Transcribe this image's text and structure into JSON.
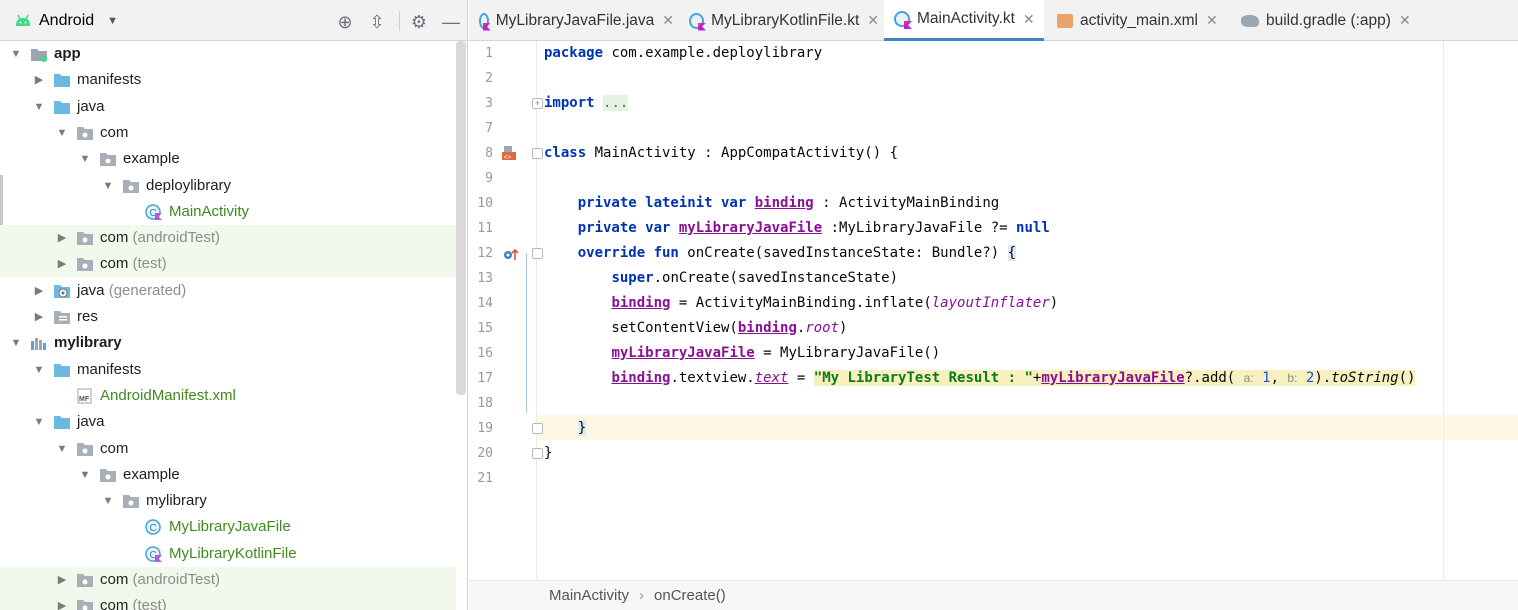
{
  "project_panel": {
    "view_name": "Android",
    "tree": [
      {
        "label": "app",
        "suffix": "",
        "type": "module",
        "depth": 0,
        "expanded": true,
        "bold": true,
        "green": false,
        "selected": false
      },
      {
        "label": "manifests",
        "suffix": "",
        "type": "folder",
        "depth": 1,
        "expanded": false,
        "bold": false,
        "green": false,
        "selected": false
      },
      {
        "label": "java",
        "suffix": "",
        "type": "folder",
        "depth": 1,
        "expanded": true,
        "bold": false,
        "green": false,
        "selected": false
      },
      {
        "label": "com",
        "suffix": "",
        "type": "package",
        "depth": 2,
        "expanded": true,
        "bold": false,
        "green": false,
        "selected": false
      },
      {
        "label": "example",
        "suffix": "",
        "type": "package",
        "depth": 3,
        "expanded": true,
        "bold": false,
        "green": false,
        "selected": false
      },
      {
        "label": "deploylibrary",
        "suffix": "",
        "type": "package",
        "depth": 4,
        "expanded": true,
        "bold": false,
        "green": false,
        "selected": false
      },
      {
        "label": "MainActivity",
        "suffix": "",
        "type": "kotlin",
        "depth": 5,
        "expanded": null,
        "bold": false,
        "green": true,
        "selected": false
      },
      {
        "label": "com",
        "suffix": "(androidTest)",
        "type": "package",
        "depth": 2,
        "expanded": false,
        "bold": false,
        "green": false,
        "selected": true
      },
      {
        "label": "com",
        "suffix": "(test)",
        "type": "package",
        "depth": 2,
        "expanded": false,
        "bold": false,
        "green": false,
        "selected": true
      },
      {
        "label": "java",
        "suffix": "(generated)",
        "type": "gen",
        "depth": 1,
        "expanded": false,
        "bold": false,
        "green": false,
        "selected": false
      },
      {
        "label": "res",
        "suffix": "",
        "type": "res",
        "depth": 1,
        "expanded": false,
        "bold": false,
        "green": false,
        "selected": false
      },
      {
        "label": "mylibrary",
        "suffix": "",
        "type": "library",
        "depth": 0,
        "expanded": true,
        "bold": true,
        "green": false,
        "selected": false
      },
      {
        "label": "manifests",
        "suffix": "",
        "type": "folder",
        "depth": 1,
        "expanded": true,
        "bold": false,
        "green": false,
        "selected": false
      },
      {
        "label": "AndroidManifest.xml",
        "suffix": "",
        "type": "manifest",
        "depth": 2,
        "expanded": null,
        "bold": false,
        "green": true,
        "selected": false
      },
      {
        "label": "java",
        "suffix": "",
        "type": "folder",
        "depth": 1,
        "expanded": true,
        "bold": false,
        "green": false,
        "selected": false
      },
      {
        "label": "com",
        "suffix": "",
        "type": "package",
        "depth": 2,
        "expanded": true,
        "bold": false,
        "green": false,
        "selected": false
      },
      {
        "label": "example",
        "suffix": "",
        "type": "package",
        "depth": 3,
        "expanded": true,
        "bold": false,
        "green": false,
        "selected": false
      },
      {
        "label": "mylibrary",
        "suffix": "",
        "type": "package",
        "depth": 4,
        "expanded": true,
        "bold": false,
        "green": false,
        "selected": false
      },
      {
        "label": "MyLibraryJavaFile",
        "suffix": "",
        "type": "java",
        "depth": 5,
        "expanded": null,
        "bold": false,
        "green": true,
        "selected": false
      },
      {
        "label": "MyLibraryKotlinFile",
        "suffix": "",
        "type": "kotlin",
        "depth": 5,
        "expanded": null,
        "bold": false,
        "green": true,
        "selected": false
      },
      {
        "label": "com",
        "suffix": "(androidTest)",
        "type": "package",
        "depth": 2,
        "expanded": false,
        "bold": false,
        "green": false,
        "selected": true
      },
      {
        "label": "com",
        "suffix": "(test)",
        "type": "package",
        "depth": 2,
        "expanded": false,
        "bold": false,
        "green": false,
        "selected": true
      }
    ]
  },
  "tabs": [
    {
      "label": "MyLibraryJavaFile.java",
      "icon": "java-class-icon",
      "active": false
    },
    {
      "label": "MyLibraryKotlinFile.kt",
      "icon": "kotlin-class-icon",
      "active": false
    },
    {
      "label": "MainActivity.kt",
      "icon": "kotlin-class-icon",
      "active": true
    },
    {
      "label": "activity_main.xml",
      "icon": "layout-xml-icon",
      "active": false
    },
    {
      "label": "build.gradle (:app)",
      "icon": "gradle-icon",
      "active": false
    }
  ],
  "editor": {
    "lines": [
      {
        "n": "1",
        "html": "<span class='kw'>package</span> com.example.deploylibrary"
      },
      {
        "n": "2",
        "html": ""
      },
      {
        "n": "3",
        "html": "<span class='kw'>import</span> <span style='background:#e8f2e3;color:#3f8a1c'>...</span>"
      },
      {
        "n": "7",
        "html": ""
      },
      {
        "n": "8",
        "html": "<span class='kw'>class</span> MainActivity : AppCompatActivity() {"
      },
      {
        "n": "9",
        "html": ""
      },
      {
        "n": "10",
        "html": "    <span class='kw'>private lateinit var</span> <span class='ul'>binding</span> : ActivityMainBinding"
      },
      {
        "n": "11",
        "html": "    <span class='kw'>private var</span> <span class='ul'>myLibraryJavaFile</span> :MyLibraryJavaFile ?= <span class='kw'>null</span>"
      },
      {
        "n": "12",
        "html": "    <span class='kw'>override fun</span> onCreate(savedInstanceState: Bundle?) <span style='background:#dfe8f6'>{</span>"
      },
      {
        "n": "13",
        "html": "        <span class='kw'>super</span>.onCreate(savedInstanceState)"
      },
      {
        "n": "14",
        "html": "        <span class='ul'>binding</span> = ActivityMainBinding.inflate(<span class='ital'>layoutInflater</span>)"
      },
      {
        "n": "15",
        "html": "        setContentView(<span class='ul'>binding</span>.<span class='ital'>root</span>)"
      },
      {
        "n": "16",
        "html": "        <span class='ul'>myLibraryJavaFile</span> = MyLibraryJavaFile()"
      },
      {
        "n": "17",
        "html": "        <span class='ul'>binding</span>.textview.<span class='ital' style='text-decoration:underline'>text</span> = <span class='str'>\"My LibraryTest Result : \"</span><span style='background:#f9f0c0'>+<span class='ul'>myLibraryJavaFile</span>?.add( <span class='hint'>a:</span> <span class='num'>1</span>, <span class='hint'>b:</span> <span class='num'>2</span>).<span style='font-style:italic'>toString</span>()</span>"
      },
      {
        "n": "18",
        "html": ""
      },
      {
        "n": "19",
        "html": "    <span style='background:#dfe8f6'>}</span>"
      },
      {
        "n": "20",
        "html": "}"
      },
      {
        "n": "21",
        "html": ""
      }
    ]
  },
  "breadcrumb": {
    "items": [
      "MainActivity",
      "onCreate()"
    ]
  }
}
